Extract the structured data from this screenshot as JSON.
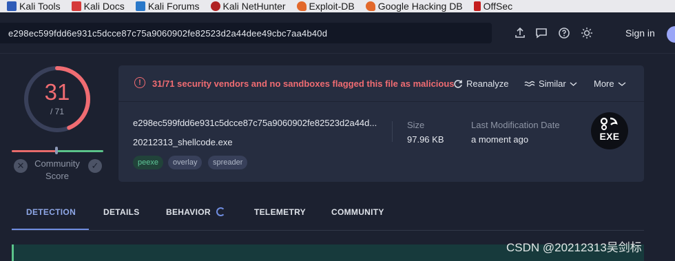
{
  "bookmarks": [
    {
      "label": "Kali Tools",
      "icon": "kali-dragon-icon"
    },
    {
      "label": "Kali Docs",
      "icon": "kali-docs-icon"
    },
    {
      "label": "Kali Forums",
      "icon": "kali-forums-icon"
    },
    {
      "label": "Kali NetHunter",
      "icon": "nethunter-icon"
    },
    {
      "label": "Exploit-DB",
      "icon": "exploit-db-icon"
    },
    {
      "label": "Google Hacking DB",
      "icon": "ghdb-icon"
    },
    {
      "label": "OffSec",
      "icon": "offsec-icon"
    }
  ],
  "header": {
    "search_value": "e298ec599fdd6e931c5dcce87c75a9060902fe82523d2a44dee49cbc7aa4b40d",
    "signin_label": "Sign in"
  },
  "score": {
    "detected": "31",
    "total": "/ 71",
    "ratio": 0.4366,
    "community_label_1": "Community",
    "community_label_2": "Score"
  },
  "alert": {
    "text": "31/71 security vendors and no sandboxes flagged this file as malicious",
    "reanalyze": "Reanalyze",
    "similar": "Similar",
    "more": "More"
  },
  "file": {
    "hash_truncated": "e298ec599fdd6e931c5dcce87c75a9060902fe82523d2a44d...",
    "name": "20212313_shellcode.exe",
    "tags": [
      "peexe",
      "overlay",
      "spreader"
    ],
    "size_label": "Size",
    "size_value": "97.96 KB",
    "modified_label": "Last Modification Date",
    "modified_value": "a moment ago",
    "type_badge": "EXE"
  },
  "tabs": [
    "DETECTION",
    "DETAILS",
    "BEHAVIOR",
    "TELEMETRY",
    "COMMUNITY"
  ],
  "colors": {
    "danger": "#f06c72",
    "accent": "#6f8de0",
    "background": "#1c2130",
    "card": "#262d40"
  },
  "watermark": "CSDN @20212313吴剑标"
}
